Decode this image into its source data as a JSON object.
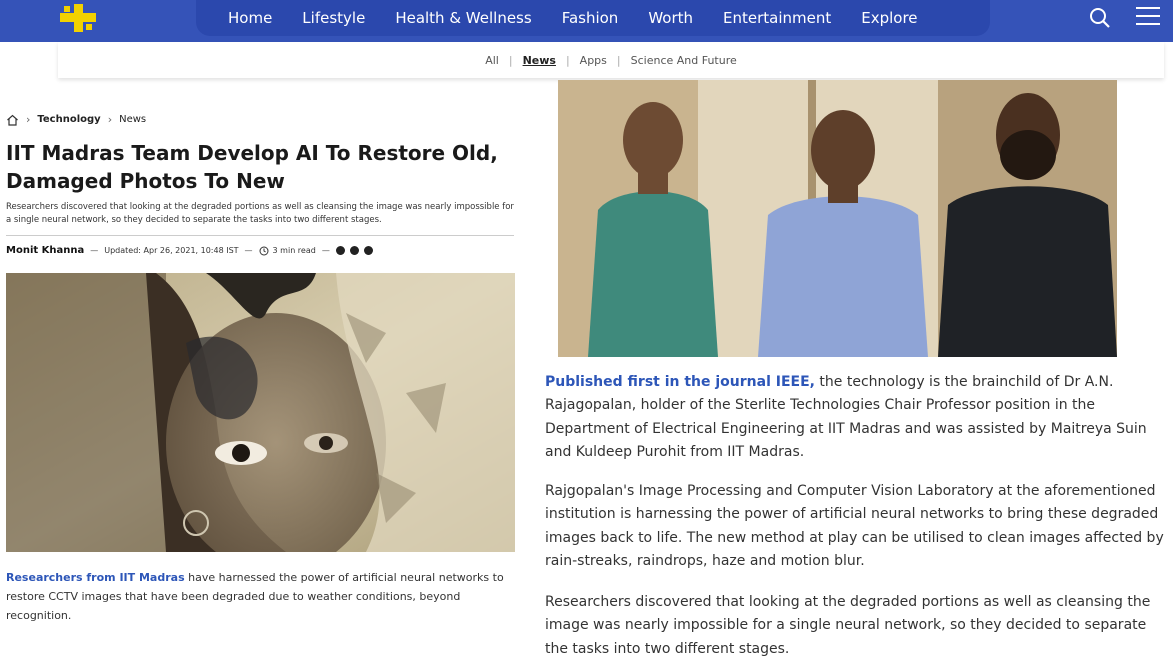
{
  "nav": {
    "items": [
      "Home",
      "Lifestyle",
      "Health & Wellness",
      "Fashion",
      "Worth",
      "Entertainment",
      "Explore"
    ],
    "search_icon": "search-icon",
    "menu_icon": "hamburger-menu-icon",
    "brand_color": "#3553b8",
    "logo_color": "#f2d100"
  },
  "subnav": {
    "items": [
      "All",
      "News",
      "Apps",
      "Science And Future"
    ],
    "active": "News"
  },
  "breadcrumb": {
    "home_icon": "home-icon",
    "items": [
      "Technology",
      "News"
    ]
  },
  "article": {
    "title": "IIT Madras Team Develop AI To Restore Old, Damaged Photos To New",
    "summary": "Researchers discovered that looking at the degraded portions as well as cleansing the image was nearly impossible for a single neural network, so they decided to separate the tasks into two different stages.",
    "author": "Monit Khanna",
    "updated": "Updated: Apr 26, 2021, 10:48 IST",
    "read_time": "3 min read",
    "share_icons": [
      "reddit-icon",
      "pinterest-icon",
      "facebook-icon"
    ],
    "caption_link": "Researchers from IIT Madras",
    "caption_rest": " have harnessed the power of artificial neural networks to restore CCTV images that have been degraded due to weather conditions, beyond recognition."
  },
  "body": {
    "p1_link": "Published first in the journal IEEE,",
    "p1_rest": " the technology is the brainchild of Dr A.N. Rajagopalan, holder of the Sterlite Technologies Chair Professor position in the Department of Electrical Engineering at IIT Madras and was assisted by Maitreya Suin and Kuldeep Purohit from IIT Madras.",
    "p2": "Rajgopalan's Image Processing and Computer Vision Laboratory at the aforementioned institution is harnessing the power of artificial neural networks to bring these degraded images back to life. The new method at play can be utilised to clean images affected by rain-streaks, raindrops, haze and motion blur.",
    "p3": "Researchers discovered that looking at the degraded portions as well as cleansing the image was nearly impossible for a single neural network, so they decided to separate the tasks into two different stages."
  }
}
